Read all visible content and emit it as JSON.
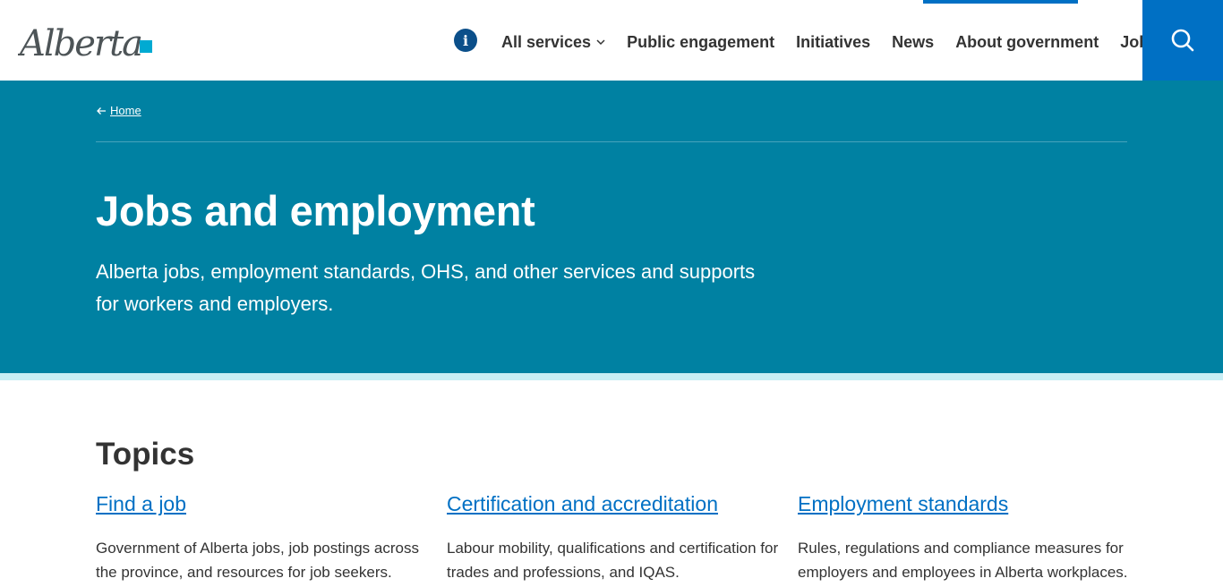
{
  "header": {
    "logo_text": "Alberta",
    "info_icon": "info-icon",
    "nav": [
      {
        "label": "All services"
      },
      {
        "label": "Public engagement"
      },
      {
        "label": "Initiatives"
      },
      {
        "label": "News"
      },
      {
        "label": "About government"
      },
      {
        "label": "Jobs"
      }
    ],
    "search_icon": "search-icon"
  },
  "hero": {
    "breadcrumb": "Home",
    "title": "Jobs and employment",
    "lead": "Alberta jobs, employment standards, OHS, and other services and supports for workers and employers."
  },
  "topics": {
    "heading": "Topics",
    "items": [
      {
        "title": "Find a job",
        "description": "Government of Alberta jobs, job postings across the province, and resources for job seekers."
      },
      {
        "title": "Certification and accreditation",
        "description": "Labour mobility, qualifications and certification for trades and professions, and IQAS."
      },
      {
        "title": "Employment standards",
        "description": "Rules, regulations and compliance measures for employers and employees in Alberta workplaces."
      }
    ]
  },
  "colors": {
    "hero_bg": "#0081a2",
    "primary_blue": "#0070c4",
    "stripe": "#c8eef5"
  }
}
